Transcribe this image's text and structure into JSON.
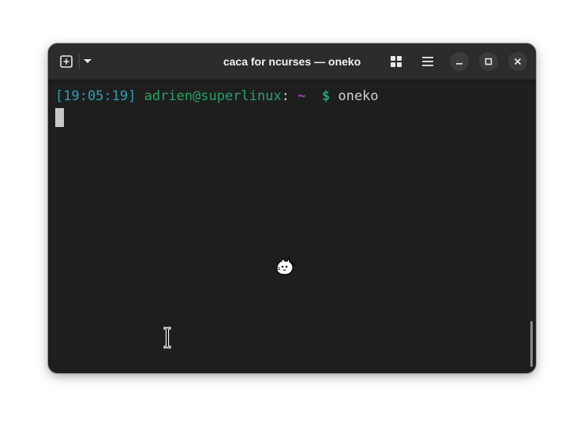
{
  "window": {
    "title": "caca for ncurses — oneko"
  },
  "titlebar": {
    "new_tab_icon": "new-tab-icon",
    "dropdown_icon": "chevron-down-icon",
    "grid_icon": "grid-view-icon",
    "menu_icon": "hamburger-menu-icon",
    "minimize_icon": "minimize-icon",
    "maximize_icon": "maximize-icon",
    "close_icon": "close-icon"
  },
  "terminal": {
    "prompt": {
      "timestamp": "[19:05:19]",
      "userhost": "adrien@superlinux",
      "colon": ":",
      "path": "~",
      "symbol": "$",
      "command": "oneko"
    }
  },
  "colors": {
    "terminal_bg": "#1e1e1e",
    "titlebar_bg": "#2c2c2c",
    "timestamp": "#2aa1b3",
    "userhost": "#26a269",
    "path": "#a347ba",
    "dollar": "#26a269",
    "text": "#d0d0d0"
  }
}
